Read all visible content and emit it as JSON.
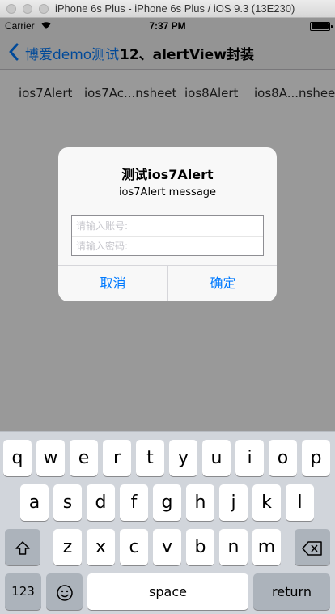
{
  "simulator": {
    "window_title": "iPhone 6s Plus - iPhone 6s Plus / iOS 9.3 (13E230)"
  },
  "status_bar": {
    "carrier": "Carrier",
    "time": "7:37 PM",
    "battery_level": 1.0
  },
  "nav_bar": {
    "back_label": "博爱demo测试",
    "title": "12、alertView封装"
  },
  "demo_buttons": [
    {
      "label": "ios7Alert"
    },
    {
      "label": "ios7Ac...nsheet"
    },
    {
      "label": "ios8Alert"
    },
    {
      "label": "ios8A...nsheet"
    }
  ],
  "alert": {
    "title": "测试ios7Alert",
    "message": "ios7Alert message",
    "account_placeholder": "请输入账号:",
    "password_placeholder": "请输入密码:",
    "cancel_label": "取消",
    "confirm_label": "确定"
  },
  "keyboard": {
    "row1": [
      "q",
      "w",
      "e",
      "r",
      "t",
      "y",
      "u",
      "i",
      "o",
      "p"
    ],
    "row2": [
      "a",
      "s",
      "d",
      "f",
      "g",
      "h",
      "j",
      "k",
      "l"
    ],
    "row3": [
      "z",
      "x",
      "c",
      "v",
      "b",
      "n",
      "m"
    ],
    "numbers_label": "123",
    "space_label": "space",
    "return_label": "return",
    "shift_icon": "shift-icon",
    "delete_icon": "delete-icon",
    "emoji_icon": "emoji-icon"
  },
  "colors": {
    "ios_blue": "#007aff",
    "keyboard_bg": "#d1d5db",
    "function_key": "#acb3bb"
  }
}
